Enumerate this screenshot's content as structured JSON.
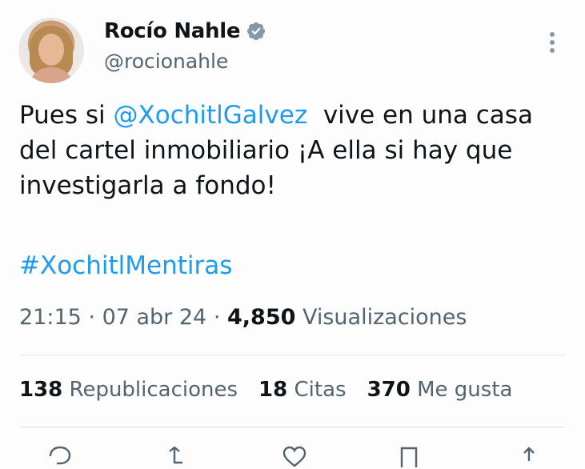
{
  "author": {
    "name": "Rocío Nahle",
    "handle": "@rocionahle"
  },
  "tweet": {
    "text_before": "Pues si ",
    "mention": "@XochitlGalvez",
    "text_after": "  vive en una casa\ndel cartel inmobiliario ¡A ella si hay que\ninvestigarla a fondo!",
    "hashtag": "#XochitlMentiras"
  },
  "meta": {
    "time": "21:15",
    "separator": " · ",
    "date": "07 abr 24",
    "views_count": "4,850",
    "views_label": " Visualizaciones"
  },
  "stats": {
    "reposts_count": "138",
    "reposts_label": " Republicaciones",
    "quotes_count": "18",
    "quotes_label": " Citas",
    "likes_count": "370",
    "likes_label": " Me gusta"
  },
  "colors": {
    "link": "#1d9bf0",
    "muted": "#536471",
    "text": "#0f1419",
    "verified": "#829aab"
  },
  "icons": [
    "verified-badge-icon",
    "more-options-icon",
    "reply-icon",
    "repost-icon",
    "like-icon",
    "bookmark-icon",
    "share-icon"
  ]
}
